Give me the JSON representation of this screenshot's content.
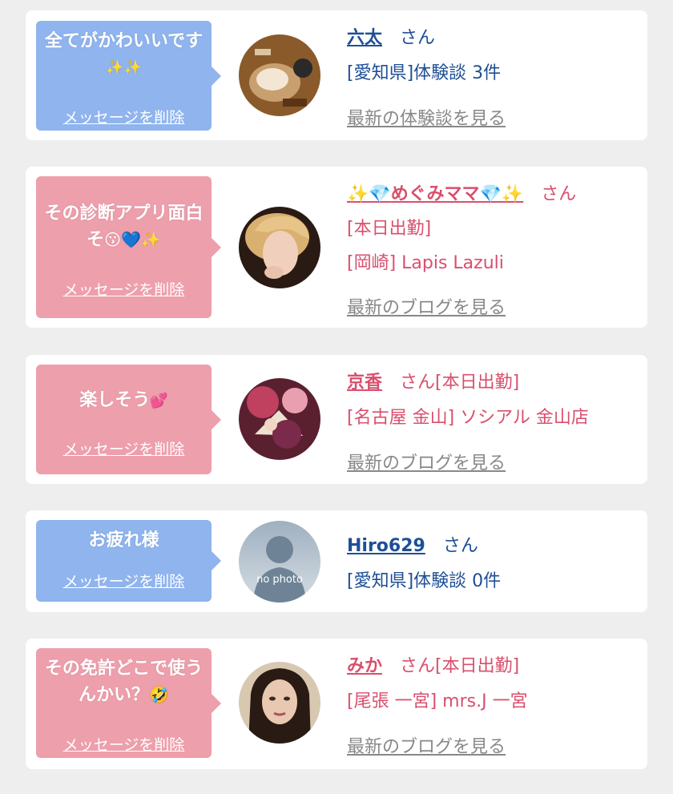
{
  "messages": [
    {
      "message": "全てがかわいいです",
      "emoji": "✨✨",
      "delete_label": "メッセージを削除",
      "name": "六太",
      "honorific": "さん",
      "line1": "[愛知県]体験談 3件",
      "link": "最新の体験談を見る",
      "colors": {
        "bubble": "#8fb4ee",
        "text": "#1f4f95"
      }
    },
    {
      "message": "その診断アプリ面白そ",
      "emoji": "😗💙✨",
      "delete_label": "メッセージを削除",
      "name": "めぐみママ",
      "name_decor_left": "✨💎",
      "name_decor_right": "💎✨",
      "honorific": "さん",
      "line1": "[本日出勤]",
      "line2": "[岡崎] Lapis Lazuli",
      "link": "最新のブログを見る",
      "colors": {
        "bubble": "#ee9fac",
        "text": "#d94f6d"
      }
    },
    {
      "message": "楽しそう",
      "emoji": "💕",
      "delete_label": "メッセージを削除",
      "name": "京香",
      "honorific": "さん[本日出勤]",
      "line1": "[名古屋 金山] ソシアル 金山店",
      "link": "最新のブログを見る",
      "colors": {
        "bubble": "#ee9fac",
        "text": "#d94f6d"
      }
    },
    {
      "message": "お疲れ様",
      "delete_label": "メッセージを削除",
      "name": "Hiro629",
      "honorific": "さん",
      "line1": "[愛知県]体験談 0件",
      "avatar_text": "no photo",
      "colors": {
        "bubble": "#8fb4ee",
        "text": "#1f4f95"
      }
    },
    {
      "message": "その免許どこで使うんかい？",
      "emoji": "🤣",
      "delete_label": "メッセージを削除",
      "name": "みか",
      "honorific": "さん[本日出勤]",
      "line1": "[尾張 一宮] mrs.J 一宮",
      "link": "最新のブログを見る",
      "colors": {
        "bubble": "#ee9fac",
        "text": "#d94f6d"
      }
    }
  ]
}
